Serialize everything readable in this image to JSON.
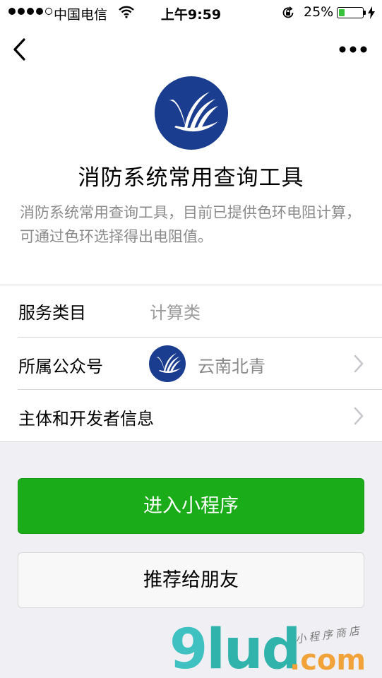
{
  "status_bar": {
    "carrier": "中国电信",
    "time": "上午9:59",
    "battery": "25%",
    "battery_level": 0.25,
    "signal_bars_filled": 4,
    "signal_bars_total": 5
  },
  "nav": {
    "back_icon": "chevron-left-icon",
    "more_icon": "ellipsis-icon"
  },
  "app": {
    "name": "消防系统常用查询工具",
    "description": "消防系统常用查询工具，目前已提供色环电阻计算，可通过色环选择得出电阻值。",
    "logo_color": "#1a3d8f"
  },
  "info": {
    "category_label": "服务类目",
    "category_value": "计算类",
    "account_label": "所属公众号",
    "account_value": "云南北青",
    "developer_label": "主体和开发者信息"
  },
  "buttons": {
    "enter": "进入小程序",
    "share": "推荐给朋友"
  },
  "watermark": {
    "main_a": "9",
    "main_b": "lud",
    "domain": ".com",
    "tagline": "小程序商店"
  },
  "colors": {
    "primary_green": "#1aad19",
    "page_bg": "#efeff4",
    "muted_text": "#9c9c9c"
  }
}
